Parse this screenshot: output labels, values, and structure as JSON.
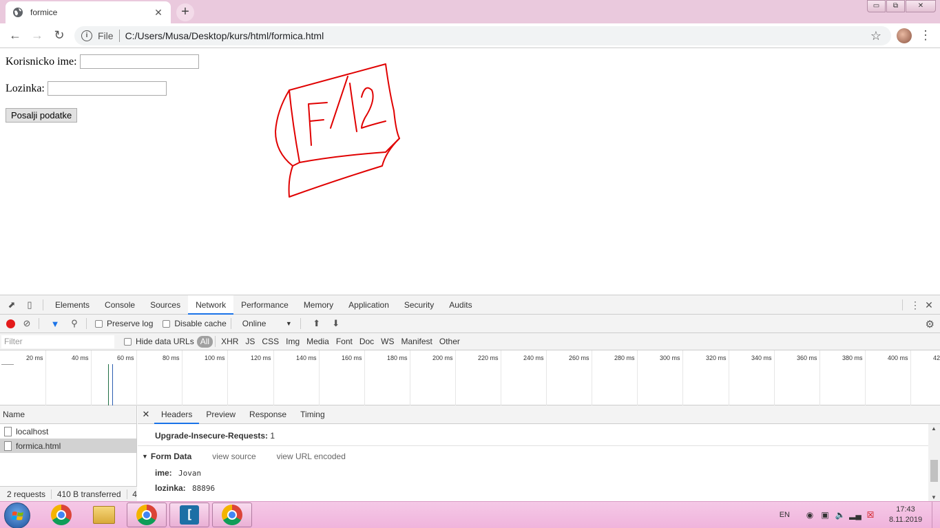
{
  "browser": {
    "tab_title": "formice",
    "new_tab": "+",
    "tab_close": "✕",
    "window_buttons": {
      "minimize": "▭",
      "maximize": "⧉",
      "close": "✕"
    },
    "omnibox_scheme": "File",
    "url": "C:/Users/Musa/Desktop/kurs/html/formica.html"
  },
  "page": {
    "username_label": "Korisnicko ime:",
    "username_value": "",
    "password_label": "Lozinka:",
    "password_value": "",
    "submit_label": "Posalji podatke",
    "annotation_color": "#e00000"
  },
  "devtools": {
    "tabs": [
      "Elements",
      "Console",
      "Sources",
      "Network",
      "Performance",
      "Memory",
      "Application",
      "Security",
      "Audits"
    ],
    "active_tab": "Network",
    "toolbar": {
      "preserve_log": "Preserve log",
      "disable_cache": "Disable cache",
      "throttling": "Online"
    },
    "filter": {
      "placeholder": "Filter",
      "hide_data_urls": "Hide data URLs",
      "types": [
        "All",
        "XHR",
        "JS",
        "CSS",
        "Img",
        "Media",
        "Font",
        "Doc",
        "WS",
        "Manifest",
        "Other"
      ]
    },
    "timeline_ticks": [
      "20 ms",
      "40 ms",
      "60 ms",
      "80 ms",
      "100 ms",
      "120 ms",
      "140 ms",
      "160 ms",
      "180 ms",
      "200 ms",
      "220 ms",
      "240 ms",
      "260 ms",
      "280 ms",
      "300 ms",
      "320 ms",
      "340 ms",
      "360 ms",
      "380 ms",
      "400 ms",
      "42"
    ],
    "requests_header": "Name",
    "requests": [
      {
        "name": "localhost",
        "selected": false
      },
      {
        "name": "formica.html",
        "selected": true
      }
    ],
    "summary": {
      "requests": "2 requests",
      "transferred": "410 B transferred",
      "more": "4"
    },
    "detail_tabs": [
      "Headers",
      "Preview",
      "Response",
      "Timing"
    ],
    "active_detail_tab": "Headers",
    "header_row": {
      "key": "Upgrade-Insecure-Requests:",
      "value": "1"
    },
    "form_data": {
      "title": "Form Data",
      "view_source": "view source",
      "view_url_encoded": "view URL encoded",
      "fields": [
        {
          "key": "ime:",
          "value": "Jovan"
        },
        {
          "key": "lozinka:",
          "value": "88896"
        }
      ]
    }
  },
  "taskbar": {
    "language": "EN",
    "time": "17:43",
    "date": "8.11.2019"
  }
}
